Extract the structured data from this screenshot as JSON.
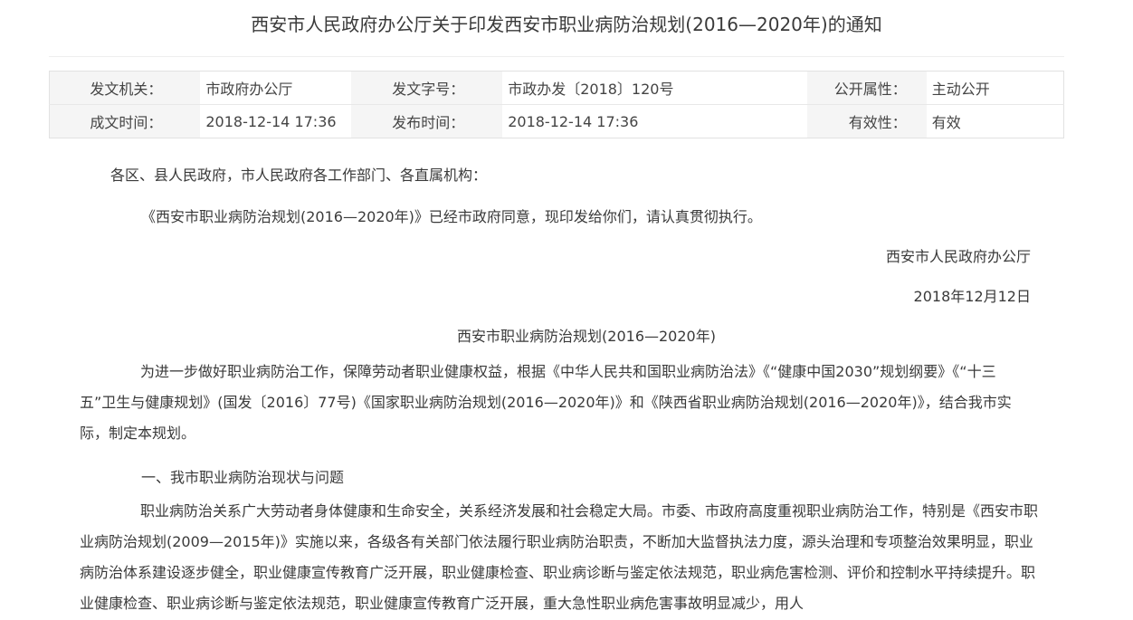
{
  "document": {
    "title": "西安市人民政府办公厅关于印发西安市职业病防治规划(2016—2020年)的通知"
  },
  "meta": {
    "row1": [
      {
        "label": "发文机关：",
        "value": "市政府办公厅"
      },
      {
        "label": "发文字号：",
        "value": "市政办发〔2018〕120号"
      },
      {
        "label": "公开属性：",
        "value": "主动公开"
      }
    ],
    "row2": [
      {
        "label": "成文时间：",
        "value": "2018-12-14 17:36"
      },
      {
        "label": "发布时间：",
        "value": "2018-12-14 17:36"
      },
      {
        "label": "有效性：",
        "value": "有效"
      }
    ]
  },
  "body": {
    "salutation": "各区、县人民政府，市人民政府各工作部门、各直属机构：",
    "notice": "《西安市职业病防治规划(2016—2020年)》已经市政府同意，现印发给你们，请认真贯彻执行。",
    "issuer": "西安市人民政府办公厅",
    "date": "2018年12月12日",
    "plan_title": "西安市职业病防治规划(2016—2020年)",
    "intro": "为进一步做好职业病防治工作，保障劳动者职业健康权益，根据《中华人民共和国职业病防治法》《“健康中国2030”规划纲要》《“十三五”卫生与健康规划》(国发〔2016〕77号)《国家职业病防治规划(2016—2020年)》和《陕西省职业病防治规划(2016—2020年)》，结合我市实际，制定本规划。",
    "section1": "一、我市职业病防治现状与问题",
    "section1_para": "职业病防治关系广大劳动者身体健康和生命安全，关系经济发展和社会稳定大局。市委、市政府高度重视职业病防治工作，特别是《西安市职业病防治规划(2009—2015年)》实施以来，各级各有关部门依法履行职业病防治职责，不断加大监督执法力度，源头治理和专项整治效果明显，职业病防治体系建设逐步健全，职业健康宣传教育广泛开展，职业健康检查、职业病诊断与鉴定依法规范，职业病危害检测、评价和控制水平持续提升。职业健康检查、职业病诊断与鉴定依法规范，职业健康宣传教育广泛开展，重大急性职业病危害事故明显减少，用人"
  }
}
